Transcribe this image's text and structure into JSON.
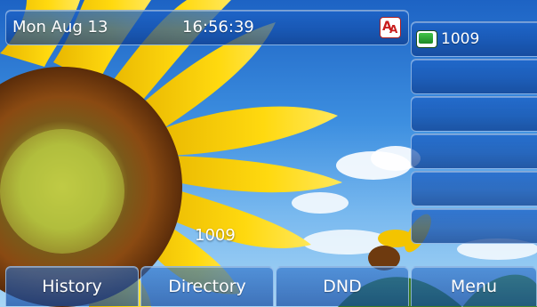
{
  "status_bar": {
    "date": "Mon Aug 13",
    "time": "16:56:39",
    "font_icon_glyphs": [
      "A",
      "A"
    ]
  },
  "line_keys": [
    {
      "label": "1009",
      "icon": "line-registered-icon"
    },
    {
      "label": ""
    },
    {
      "label": ""
    },
    {
      "label": ""
    },
    {
      "label": ""
    },
    {
      "label": ""
    }
  ],
  "account_label": "1009",
  "softkeys": [
    {
      "label": "History"
    },
    {
      "label": "Directory"
    },
    {
      "label": "DND"
    },
    {
      "label": "Menu"
    }
  ],
  "colors": {
    "accent_blue": "#1e64c8",
    "line_status_green": "#2fae34",
    "font_icon_red": "#c81c1c"
  }
}
